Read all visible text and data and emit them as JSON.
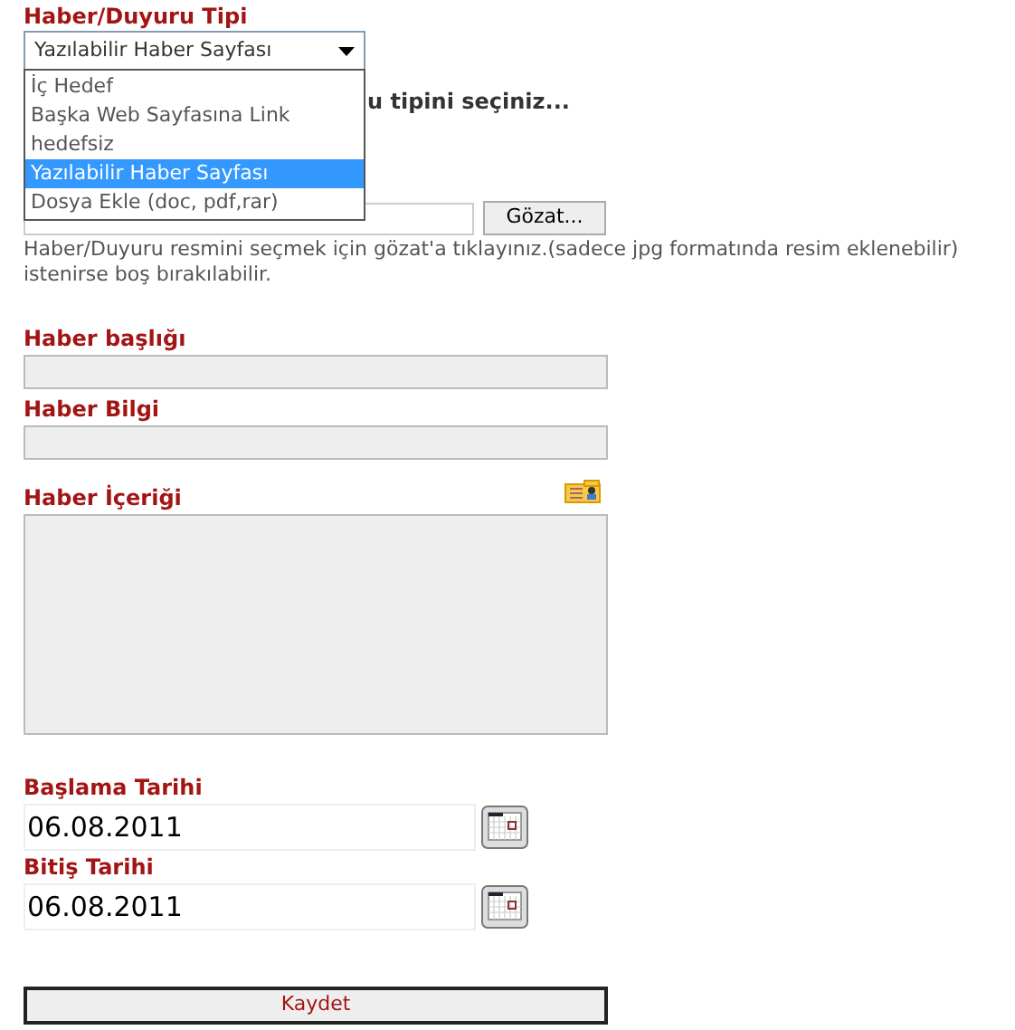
{
  "type_label": "Haber/Duyuru Tipi",
  "type_select": {
    "value": "Yazılabilir Haber Sayfası",
    "expanded": true,
    "options": [
      {
        "label": "İç Hedef",
        "selected": false
      },
      {
        "label": "Başka Web Sayfasına Link",
        "selected": false
      },
      {
        "label": "hedefsiz",
        "selected": false
      },
      {
        "label": "Yazılabilir Haber Sayfası",
        "selected": true
      },
      {
        "label": "Dosya Ekle (doc, pdf,rar)",
        "selected": false
      }
    ]
  },
  "type_hint": "u tipini seçiniz...",
  "browse_button": "Gözat...",
  "image_help": "Haber/Duyuru resmini seçmek için gözat'a tıklayınız.(sadece jpg formatında resim eklenebilir) istenirse boş bırakılabilir.",
  "title_label": "Haber başlığı",
  "info_label": "Haber Bilgi",
  "content_label": "Haber İçeriği",
  "start_label": "Başlama Tarihi",
  "start_date": "06.08.2011",
  "end_label": "Bitiş Tarihi",
  "end_date": "06.08.2011",
  "save_button": "Kaydet"
}
